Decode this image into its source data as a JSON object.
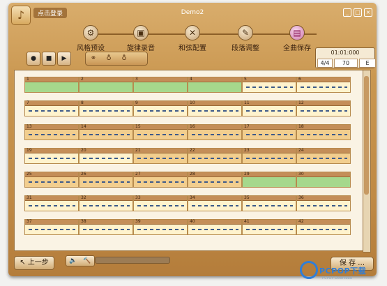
{
  "window": {
    "title": "Demo2",
    "login_label": "点击登录",
    "logo_icon": "music-note-icon"
  },
  "toolbar": {
    "tools": [
      {
        "label": "风格预设",
        "icon": "gear-icon",
        "glyph": "⚙",
        "selected": false
      },
      {
        "label": "旋律录音",
        "icon": "folder-icon",
        "glyph": "▣",
        "selected": false
      },
      {
        "label": "和弦配置",
        "icon": "tools-icon",
        "glyph": "✕",
        "selected": false
      },
      {
        "label": "段落调整",
        "icon": "edit-icon",
        "glyph": "✎",
        "selected": false
      },
      {
        "label": "全曲保存",
        "icon": "save-icon",
        "glyph": "▤",
        "selected": true
      }
    ]
  },
  "transport": {
    "record": "●",
    "stop": "■",
    "play": "▶"
  },
  "options": [
    "⚭",
    "♁",
    "♁"
  ],
  "status": {
    "time": "01:01:000",
    "meter": "4/4",
    "tempo": "70",
    "key": "E"
  },
  "bars": [
    {
      "n": "1",
      "style": "green"
    },
    {
      "n": "2",
      "style": "green"
    },
    {
      "n": "3",
      "style": "green"
    },
    {
      "n": "4",
      "style": "green"
    },
    {
      "n": "5",
      "style": "light"
    },
    {
      "n": "6",
      "style": "light"
    },
    {
      "n": "7",
      "style": "light"
    },
    {
      "n": "8",
      "style": "light"
    },
    {
      "n": "9",
      "style": "light"
    },
    {
      "n": "10",
      "style": "light"
    },
    {
      "n": "11",
      "style": "light"
    },
    {
      "n": "12",
      "style": "light"
    },
    {
      "n": "13",
      "style": "orange"
    },
    {
      "n": "14",
      "style": "orange"
    },
    {
      "n": "15",
      "style": "orange"
    },
    {
      "n": "16",
      "style": "orange"
    },
    {
      "n": "17",
      "style": "orange"
    },
    {
      "n": "18",
      "style": "orange"
    },
    {
      "n": "19",
      "style": "light"
    },
    {
      "n": "20",
      "style": "light"
    },
    {
      "n": "21",
      "style": "orange"
    },
    {
      "n": "22",
      "style": "orange"
    },
    {
      "n": "23",
      "style": "orange"
    },
    {
      "n": "24",
      "style": "orange"
    },
    {
      "n": "25",
      "style": "orange"
    },
    {
      "n": "26",
      "style": "orange"
    },
    {
      "n": "27",
      "style": "orange"
    },
    {
      "n": "28",
      "style": "orange"
    },
    {
      "n": "29",
      "style": "green"
    },
    {
      "n": "30",
      "style": "green"
    },
    {
      "n": "31",
      "style": "light"
    },
    {
      "n": "32",
      "style": "light"
    },
    {
      "n": "33",
      "style": "light"
    },
    {
      "n": "34",
      "style": "light"
    },
    {
      "n": "35",
      "style": "light"
    },
    {
      "n": "36",
      "style": "light"
    },
    {
      "n": "37",
      "style": "light"
    },
    {
      "n": "38",
      "style": "light"
    },
    {
      "n": "39",
      "style": "light"
    },
    {
      "n": "40",
      "style": "light"
    },
    {
      "n": "41",
      "style": "light"
    },
    {
      "n": "42",
      "style": "light"
    }
  ],
  "bottom": {
    "back_label": "上一步",
    "save_label": "保 存 …",
    "volume_icon": "🔈",
    "tool_icon": "🔨"
  },
  "watermark": {
    "brand": "PCPOP下载",
    "sub": "PCPOP Download"
  },
  "colors": {
    "bar_green": "#a6d88c",
    "bar_light": "#fff3cd",
    "bar_orange": "#f2ce8e",
    "accent": "#cf7aac"
  }
}
